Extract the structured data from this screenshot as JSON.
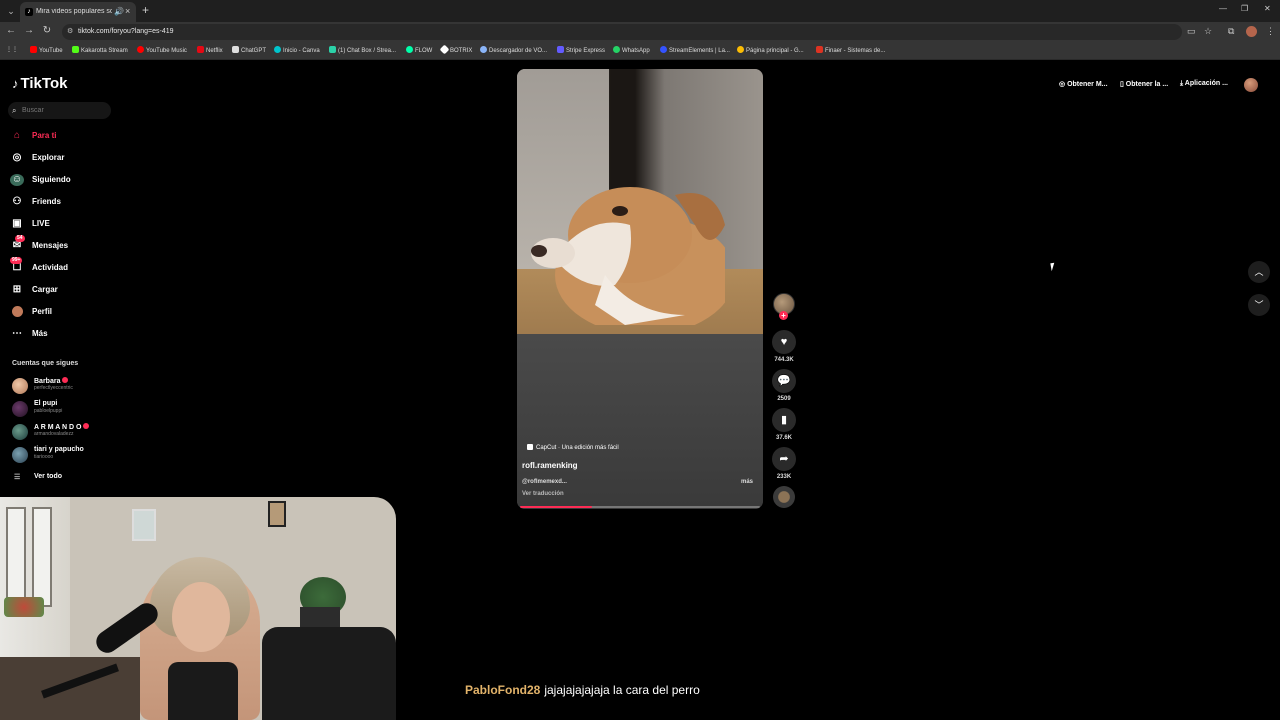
{
  "browser": {
    "tab_title": "Mira videos populares sobre",
    "url": "tiktok.com/foryou?lang=es-419",
    "bookmarks": [
      "YouTube",
      "Kakarotta Stream",
      "YouTube Music",
      "Netflix",
      "ChatGPT",
      "Inicio - Canva",
      "(1) Chat Box / Strea...",
      "FLOW",
      "BOTRIX",
      "Descargador de VO...",
      "Stripe Express",
      "WhatsApp",
      "StreamElements | La...",
      "Página principal - G...",
      "Finaer - Sistemas de..."
    ]
  },
  "tiktok": {
    "logo": "TikTok",
    "search_placeholder": "Buscar",
    "nav": [
      {
        "label": "Para ti",
        "icon": "home-icon",
        "active": true
      },
      {
        "label": "Explorar",
        "icon": "compass-icon"
      },
      {
        "label": "Siguiendo",
        "icon": "following-icon"
      },
      {
        "label": "Friends",
        "icon": "friends-icon"
      },
      {
        "label": "LIVE",
        "icon": "live-icon"
      },
      {
        "label": "Mensajes",
        "icon": "messages-icon",
        "badge": "54"
      },
      {
        "label": "Actividad",
        "icon": "activity-icon",
        "badge": "99+"
      },
      {
        "label": "Cargar",
        "icon": "upload-icon"
      },
      {
        "label": "Perfil",
        "icon": "profile-icon"
      },
      {
        "label": "Más",
        "icon": "more-icon"
      }
    ],
    "following_title": "Cuentas que sigues",
    "following": [
      {
        "name": "Barbara",
        "handle": "perfectlyeccentric",
        "verified": true
      },
      {
        "name": "El pupi",
        "handle": "pabloelpuppi",
        "verified": false
      },
      {
        "name": "A R M A N D O",
        "handle": "armandovaladezz",
        "verified": true
      },
      {
        "name": "tiari y papucho",
        "handle": "tiarioooo",
        "verified": false
      }
    ],
    "see_all": "Ver todo",
    "top_right": [
      "Obtener M...",
      "Obtener la ...",
      "Aplicación ..."
    ]
  },
  "video": {
    "capcut_label": "CapCut · Una edición más fácil",
    "username": "rofl.ramenking",
    "description": "@roflmemexd...",
    "more": "más",
    "translate": "Ver traducción",
    "progress": 0.3,
    "likes": "744.3K",
    "comments": "2509",
    "saves": "37.6K",
    "shares": "233K"
  },
  "chat": {
    "user": "PabloFond28",
    "message": "jajajajajajaja la cara del perro"
  },
  "colors": {
    "accent": "#fe2c55",
    "chat_user": "#e2b36a"
  }
}
